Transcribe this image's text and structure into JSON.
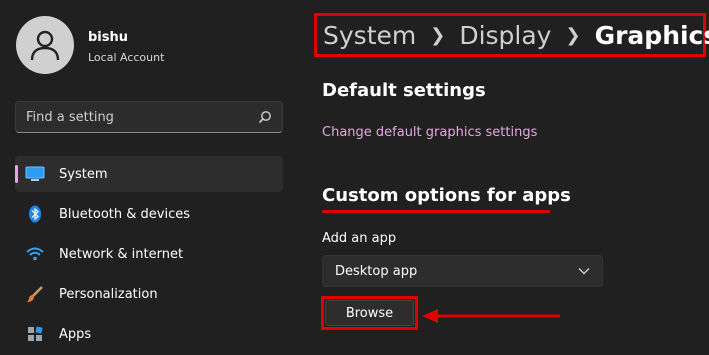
{
  "user": {
    "name": "bishu",
    "account_type": "Local Account"
  },
  "search": {
    "placeholder": "Find a setting"
  },
  "sidebar": {
    "items": [
      {
        "label": "System",
        "icon": "monitor-icon",
        "active": true
      },
      {
        "label": "Bluetooth & devices",
        "icon": "bluetooth-icon"
      },
      {
        "label": "Network & internet",
        "icon": "wifi-icon"
      },
      {
        "label": "Personalization",
        "icon": "paintbrush-icon"
      },
      {
        "label": "Apps",
        "icon": "apps-icon"
      }
    ]
  },
  "breadcrumb": {
    "items": [
      "System",
      "Display",
      "Graphics"
    ]
  },
  "main": {
    "default_settings": {
      "title": "Default settings",
      "link": "Change default graphics settings"
    },
    "custom_options": {
      "title": "Custom options for apps",
      "add_label": "Add an app",
      "dropdown_value": "Desktop app",
      "browse_label": "Browse"
    }
  },
  "colors": {
    "background": "#202020",
    "accent": "#e6a8e0",
    "annotation": "#e00000"
  }
}
